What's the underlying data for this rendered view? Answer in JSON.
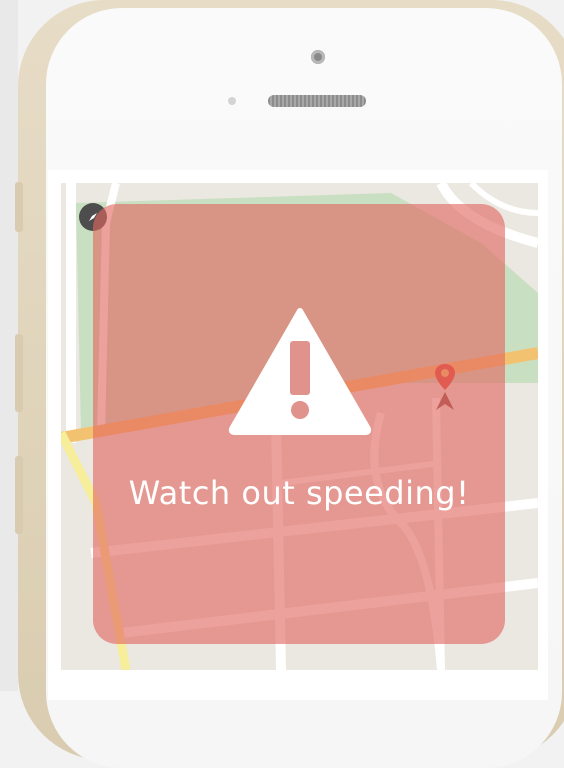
{
  "alert": {
    "message": "Watch out speeding!"
  },
  "icons": {
    "compass": "compass-icon",
    "warning": "warning-triangle-icon",
    "pin": "location-pin-icon"
  },
  "colors": {
    "alert_overlay": "#e26860",
    "map_background": "#ebe7e1",
    "park_green": "#c9dfc2",
    "highway_orange": "#f1b25b",
    "phone_gold": "#e4d8c0"
  }
}
